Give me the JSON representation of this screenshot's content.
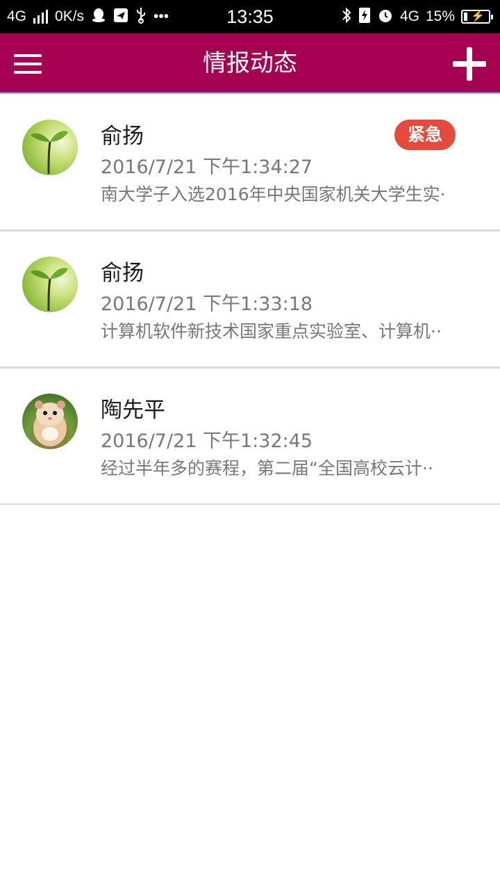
{
  "status_bar": {
    "network_left": "4G",
    "speed": "0K/s",
    "dots": "•••",
    "time": "13:35",
    "network_right": "4G",
    "battery": "15%"
  },
  "app_bar": {
    "title": "情报动态",
    "background_color": "#a50052"
  },
  "items": [
    {
      "name": "俞扬",
      "time": "2016/7/21 下午1:34:27",
      "summary": "南大学子入选2016年中央国家机关大学生实·",
      "badge": "紧急",
      "avatar": "sprout-avatar"
    },
    {
      "name": "俞扬",
      "time": "2016/7/21 下午1:33:18",
      "summary": "计算机软件新技术国家重点实验室、计算机··",
      "avatar": "sprout-avatar"
    },
    {
      "name": "陶先平",
      "time": "2016/7/21 下午1:32:45",
      "summary": "经过半年多的赛程，第二届“全国高校云计··",
      "avatar": "hamster-avatar"
    }
  ],
  "colors": {
    "badge": "#e64a3c",
    "divider": "#dcdcdc"
  }
}
